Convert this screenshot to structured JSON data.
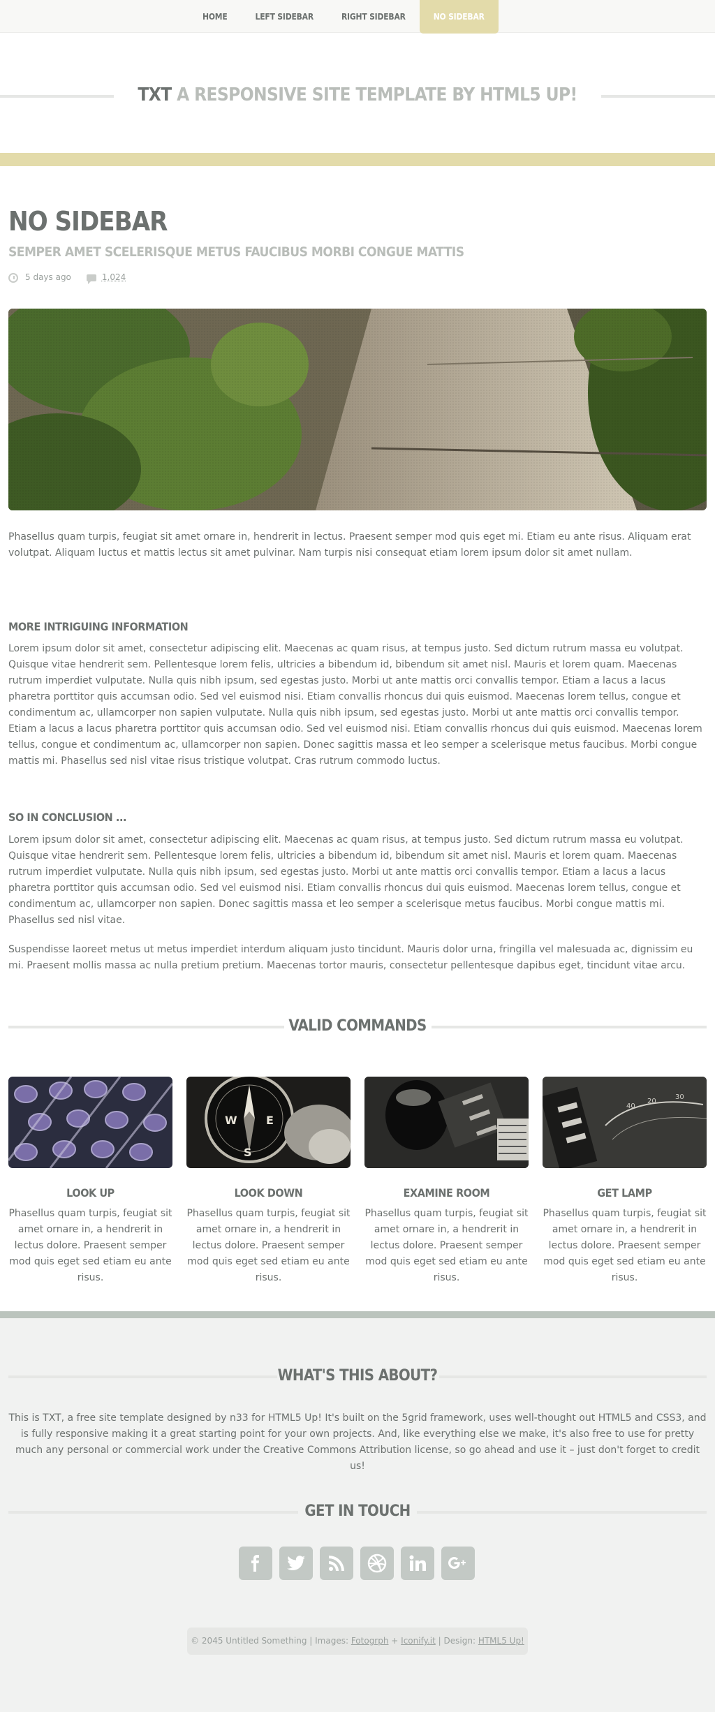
{
  "nav": {
    "items": [
      {
        "label": "HOME",
        "active": false
      },
      {
        "label": "LEFT SIDEBAR",
        "active": false
      },
      {
        "label": "RIGHT SIDEBAR",
        "active": false
      },
      {
        "label": "NO SIDEBAR",
        "active": true
      }
    ]
  },
  "header": {
    "title_strong": "TXT",
    "title_rest": "A RESPONSIVE SITE TEMPLATE BY HTML5 UP!"
  },
  "colors": {
    "accent": "#e3dbaa",
    "text": "#6c716f",
    "muted": "#b9bdb9",
    "footer_bg": "#f1f2f1",
    "footer_border": "#bbc4bd"
  },
  "article": {
    "title": "NO SIDEBAR",
    "subtitle": "SEMPER AMET SCELERISQUE METUS FAUCIBUS MORBI CONGUE MATTIS",
    "meta": {
      "time_icon": "clock-icon",
      "time": "5 days ago",
      "comments_icon": "comment-icon",
      "comments": "1,024"
    },
    "intro": "Phasellus quam turpis, feugiat sit amet ornare in, hendrerit in lectus. Praesent semper mod quis eget mi. Etiam eu ante risus. Aliquam erat volutpat. Aliquam luctus et mattis lectus sit amet pulvinar. Nam turpis nisi consequat etiam lorem ipsum dolor sit amet nullam.",
    "sections": [
      {
        "heading": "MORE INTRIGUING INFORMATION",
        "body": "Lorem ipsum dolor sit amet, consectetur adipiscing elit. Maecenas ac quam risus, at tempus justo. Sed dictum rutrum massa eu volutpat. Quisque vitae hendrerit sem. Pellentesque lorem felis, ultricies a bibendum id, bibendum sit amet nisl. Mauris et lorem quam. Maecenas rutrum imperdiet vulputate. Nulla quis nibh ipsum, sed egestas justo. Morbi ut ante mattis orci convallis tempor. Etiam a lacus a lacus pharetra porttitor quis accumsan odio. Sed vel euismod nisi. Etiam convallis rhoncus dui quis euismod. Maecenas lorem tellus, congue et condimentum ac, ullamcorper non sapien vulputate. Nulla quis nibh ipsum, sed egestas justo. Morbi ut ante mattis orci convallis tempor. Etiam a lacus a lacus pharetra porttitor quis accumsan odio. Sed vel euismod nisi. Etiam convallis rhoncus dui quis euismod. Maecenas lorem tellus, congue et condimentum ac, ullamcorper non sapien. Donec sagittis massa et leo semper a scelerisque metus faucibus. Morbi congue mattis mi. Phasellus sed nisl vitae risus tristique volutpat. Cras rutrum commodo luctus."
      },
      {
        "heading": "SO IN CONCLUSION ...",
        "body": "Lorem ipsum dolor sit amet, consectetur adipiscing elit. Maecenas ac quam risus, at tempus justo. Sed dictum rutrum massa eu volutpat. Quisque vitae hendrerit sem. Pellentesque lorem felis, ultricies a bibendum id, bibendum sit amet nisl. Mauris et lorem quam. Maecenas rutrum imperdiet vulputate. Nulla quis nibh ipsum, sed egestas justo. Morbi ut ante mattis orci convallis tempor. Etiam a lacus a lacus pharetra porttitor quis accumsan odio. Sed vel euismod nisi. Etiam convallis rhoncus dui quis euismod. Maecenas lorem tellus, congue et condimentum ac, ullamcorper non sapien. Donec sagittis massa et leo semper a scelerisque metus faucibus. Morbi congue mattis mi. Phasellus sed nisl vitae."
      }
    ],
    "closing": "Suspendisse laoreet metus ut metus imperdiet interdum aliquam justo tincidunt. Mauris dolor urna, fringilla vel malesuada ac, dignissim eu mi. Praesent mollis massa ac nulla pretium pretium. Maecenas tortor mauris, consectetur pellentesque dapibus eget, tincidunt vitae arcu."
  },
  "commands": {
    "heading": "VALID COMMANDS",
    "items": [
      {
        "title": "LOOK UP",
        "text": "Phasellus quam turpis, feugiat sit amet ornare in, a hendrerit in lectus dolore. Praesent semper mod quis eget sed etiam eu ante risus."
      },
      {
        "title": "LOOK DOWN",
        "text": "Phasellus quam turpis, feugiat sit amet ornare in, a hendrerit in lectus dolore. Praesent semper mod quis eget sed etiam eu ante risus."
      },
      {
        "title": "EXAMINE ROOM",
        "text": "Phasellus quam turpis, feugiat sit amet ornare in, a hendrerit in lectus dolore. Praesent semper mod quis eget sed etiam eu ante risus."
      },
      {
        "title": "GET LAMP",
        "text": "Phasellus quam turpis, feugiat sit amet ornare in, a hendrerit in lectus dolore. Praesent semper mod quis eget sed etiam eu ante risus."
      }
    ]
  },
  "footer": {
    "about_heading": "WHAT'S THIS ABOUT?",
    "about_text": "This is TXT, a free site template designed by n33 for HTML5 Up! It's built on the 5grid framework, uses well-thought out HTML5 and CSS3, and is fully responsive making it a great starting point for your own projects. And, like everything else we make, it's also free to use for pretty much any personal or commercial work under the Creative Commons Attribution license, so go ahead and use it – just don't forget to credit us!",
    "touch_heading": "GET IN TOUCH",
    "socials": [
      {
        "icon": "facebook-icon",
        "glyph": "f"
      },
      {
        "icon": "twitter-icon",
        "glyph": "t"
      },
      {
        "icon": "rss-icon",
        "glyph": ""
      },
      {
        "icon": "dribbble-icon",
        "glyph": ""
      },
      {
        "icon": "linkedin-icon",
        "glyph": "in"
      },
      {
        "icon": "googleplus-icon",
        "glyph": "g+"
      }
    ],
    "copyright": {
      "prefix": "© 2045 Untitled Something | Images: ",
      "link1": "Fotogrph",
      "plus": " + ",
      "link2": "Iconify.it",
      "design": " | Design: ",
      "link3": "HTML5 Up!"
    }
  }
}
